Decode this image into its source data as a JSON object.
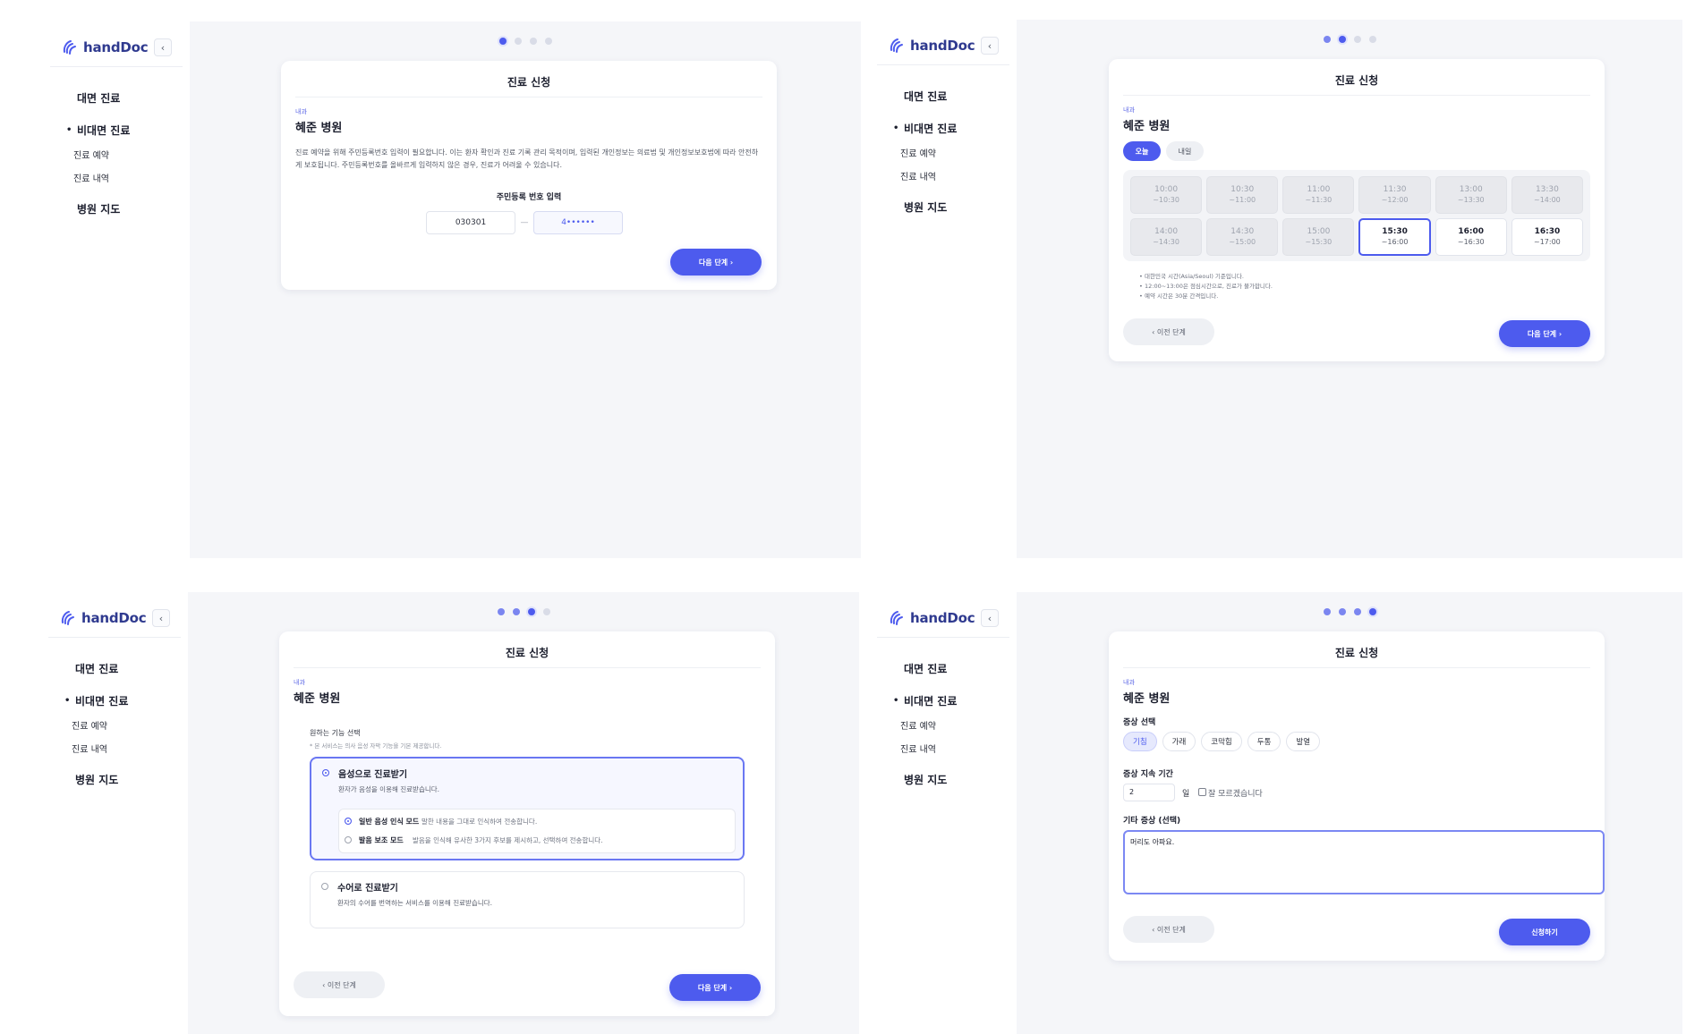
{
  "app": {
    "name": "handDoc",
    "collapse_icon": "chevron-left-icon",
    "logo_icon": "hand-wave-icon"
  },
  "nav": {
    "face_to_face": "대면 진료",
    "remote": "비대면 진료",
    "remote_reserve": "진료 예약",
    "remote_history": "진료 내역",
    "hospital_map": "병원 지도"
  },
  "common": {
    "card_title": "진료 신청",
    "department": "내과",
    "hospital": "혜준 병원",
    "next_label": "다음 단계 ›",
    "prev_label": "‹ 이전 단계",
    "submit_label": "신청하기"
  },
  "step1": {
    "notice": "진료 예약을 위해 주민등록번호 입력이 필요합니다. 이는 환자 확인과 진료 기록 관리 목적이며, 입력된 개인정보는 의료법 및 개인정보보호법에 따라 안전하게 보호됩니다. 주민등록번호를 올바르게 입력하지 않은 경우, 진료가 어려울 수 있습니다.",
    "rrn_label": "주민등록 번호 입력",
    "rrn_front": "030301",
    "rrn_dash": "—",
    "rrn_back": "4••••••"
  },
  "step2": {
    "tabs": [
      {
        "label": "오늘",
        "active": true
      },
      {
        "label": "내일",
        "active": false
      }
    ],
    "slots": [
      {
        "from": "10:00",
        "to": "~10:30",
        "state": "disabled"
      },
      {
        "from": "10:30",
        "to": "~11:00",
        "state": "disabled"
      },
      {
        "from": "11:00",
        "to": "~11:30",
        "state": "disabled"
      },
      {
        "from": "11:30",
        "to": "~12:00",
        "state": "disabled"
      },
      {
        "from": "13:00",
        "to": "~13:30",
        "state": "disabled"
      },
      {
        "from": "13:30",
        "to": "~14:00",
        "state": "disabled"
      },
      {
        "from": "14:00",
        "to": "~14:30",
        "state": "disabled"
      },
      {
        "from": "14:30",
        "to": "~15:00",
        "state": "disabled"
      },
      {
        "from": "15:00",
        "to": "~15:30",
        "state": "disabled"
      },
      {
        "from": "15:30",
        "to": "~16:00",
        "state": "selected"
      },
      {
        "from": "16:00",
        "to": "~16:30",
        "state": "avail"
      },
      {
        "from": "16:30",
        "to": "~17:00",
        "state": "avail"
      }
    ],
    "notes": [
      "대한민국 시간(Asia/Seoul) 기준입니다.",
      "12:00~13:00은 점심시간으로, 진료가 불가합니다.",
      "예약 시간은 30분 간격입니다."
    ]
  },
  "step3": {
    "feature_label": "원하는 기능 선택",
    "feature_note": "* 본 서비스는 의사 음성 자막 기능을 기본 제공합니다.",
    "voice": {
      "title": "음성으로 진료받기",
      "desc": "환자가 음성을 이용해 진료받습니다."
    },
    "voice_modes": [
      {
        "title": "일반 음성 인식 모드",
        "desc": "말한 내용을 그대로 인식하여 전송합니다.",
        "selected": true
      },
      {
        "title": "발음 보조 모드",
        "desc": "발음을 인식해 유사한 3가지 후보를 제시하고, 선택하여 전송합니다.",
        "selected": false
      }
    ],
    "sign": {
      "title": "수어로 진료받기",
      "desc": "환자의 수어를 번역하는 서비스를 이용해 진료받습니다."
    }
  },
  "step4": {
    "symptom_label": "증상 선택",
    "symptoms": [
      {
        "label": "기침",
        "selected": true
      },
      {
        "label": "가래",
        "selected": false
      },
      {
        "label": "코막힘",
        "selected": false
      },
      {
        "label": "두통",
        "selected": false
      },
      {
        "label": "발열",
        "selected": false
      }
    ],
    "duration_label": "증상 지속 기간",
    "duration_value": "2",
    "duration_unit": "일",
    "unknown_label": "잘 모르겠습니다",
    "other_label": "기타 증상 (선택)",
    "other_value": "머리도 아파요."
  },
  "colors": {
    "accent": "#4d5bee",
    "background": "#f5f6f9",
    "card": "#ffffff"
  }
}
